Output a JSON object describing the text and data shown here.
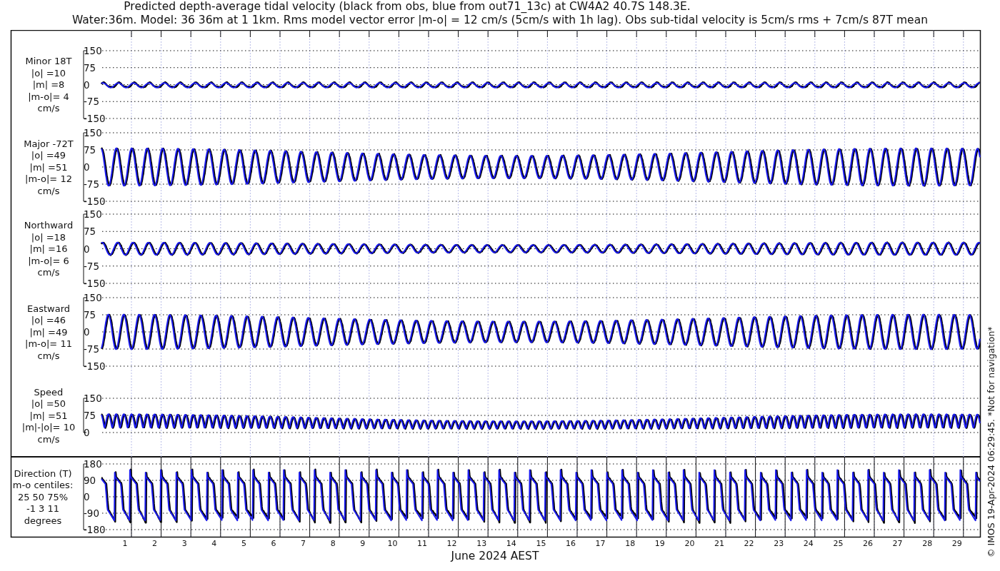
{
  "title_lines": [
    "Predicted depth-average tidal velocity (black from obs, blue from out71_13c) at CW4A2 40.7S 148.3E.",
    "Water:36m. Model: 36 36m at 1 1km. Rms model vector error |m-o| = 12 cm/s (5cm/s with 1h lag). Obs sub-tidal velocity is 5cm/s rms + 7cm/s 87T mean"
  ],
  "panels": [
    {
      "kind": "minor",
      "label_lines": [
        "Minor 18T",
        "|o| =10",
        "|m| =8",
        "|m-o|= 4",
        "cm/s"
      ],
      "yticks": [
        "150",
        "75",
        "0",
        "-75",
        "-150"
      ]
    },
    {
      "kind": "major",
      "label_lines": [
        "Major -72T",
        "|o| =49",
        "|m| =51",
        "|m-o|= 12",
        "cm/s"
      ],
      "yticks": [
        "150",
        "75",
        "0",
        "-75",
        "-150"
      ]
    },
    {
      "kind": "northward",
      "label_lines": [
        "Northward",
        "|o| =18",
        "|m| =16",
        "|m-o|= 6",
        "cm/s"
      ],
      "yticks": [
        "150",
        "75",
        "0",
        "-75",
        "-150"
      ]
    },
    {
      "kind": "eastward",
      "label_lines": [
        "Eastward",
        "|o| =46",
        "|m| =49",
        "|m-o|= 11",
        "cm/s"
      ],
      "yticks": [
        "150",
        "75",
        "0",
        "-75",
        "-150"
      ]
    },
    {
      "kind": "speed",
      "label_lines": [
        "Speed",
        "|o| =50",
        "|m| =51",
        "|m|-|o|= 10",
        "cm/s"
      ],
      "yticks": [
        "150",
        "75",
        "0"
      ]
    },
    {
      "kind": "direction",
      "label_lines": [
        "Direction (T)",
        "m-o centiles:",
        "25 50 75%",
        "-1 3 11",
        "degrees"
      ],
      "yticks": [
        "180",
        "90",
        "0",
        "-90",
        "-180"
      ]
    }
  ],
  "days": [
    "1",
    "2",
    "3",
    "4",
    "5",
    "6",
    "7",
    "8",
    "9",
    "10",
    "11",
    "12",
    "13",
    "14",
    "15",
    "16",
    "17",
    "18",
    "19",
    "20",
    "21",
    "22",
    "23",
    "24",
    "25",
    "26",
    "27",
    "28",
    "29"
  ],
  "xlabel": "June 2024 AEST",
  "footer": "© IMOS 19-Apr-2024 06:29:45. *Not for navigation*"
}
